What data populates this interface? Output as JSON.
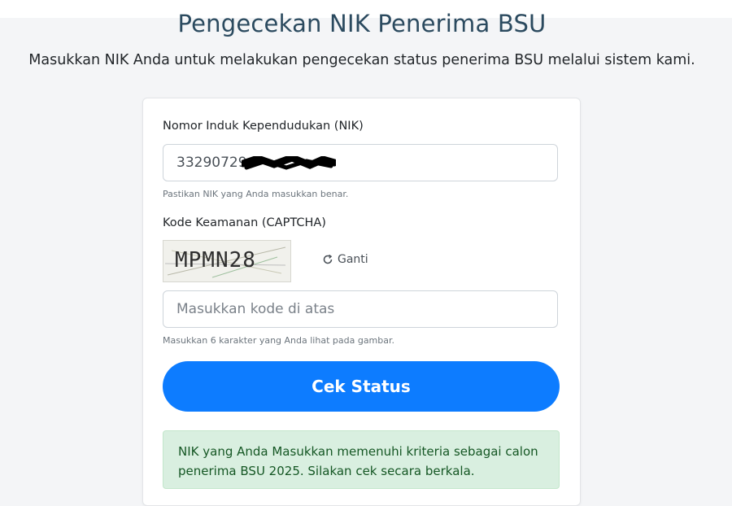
{
  "header": {
    "title": "Pengecekan NIK Penerima BSU",
    "subtitle": "Masukkan NIK Anda untuk melakukan pengecekan status penerima BSU melalui sistem kami."
  },
  "form": {
    "nik_label": "Nomor Induk Kependudukan (NIK)",
    "nik_value": "33290729",
    "nik_helper": "Pastikan NIK yang Anda masukkan benar.",
    "captcha_label": "Kode Keamanan (CAPTCHA)",
    "captcha_text": "MPMN28",
    "refresh_icon": "refresh-icon",
    "refresh_label": "Ganti",
    "captcha_placeholder": "Masukkan kode di atas",
    "captcha_helper": "Masukkan 6 karakter yang Anda lihat pada gambar.",
    "submit_label": "Cek Status"
  },
  "result": {
    "message": "NIK yang Anda Masukkan memenuhi kriteria sebagai calon penerima BSU 2025. Silakan cek secara berkala."
  },
  "colors": {
    "primary": "#0d7cff",
    "title": "#2b4a5f",
    "success_bg": "#d9efe0",
    "success_text": "#155724"
  }
}
